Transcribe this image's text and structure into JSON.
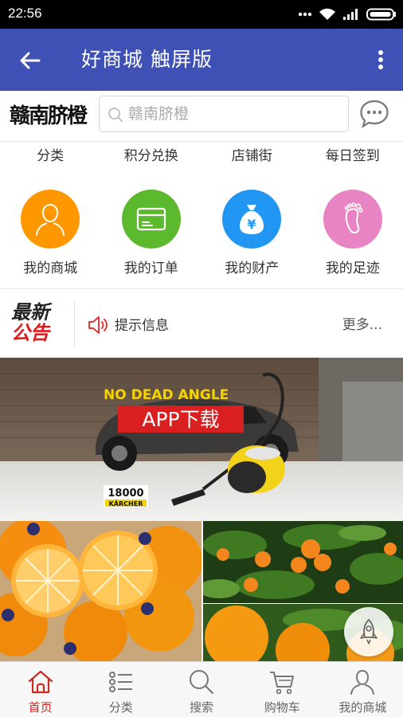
{
  "status_bar": {
    "time": "22:56"
  },
  "app_bar": {
    "title": "好商城 触屏版"
  },
  "header": {
    "logo_text": "赣南脐橙",
    "search_placeholder": "赣南脐橙"
  },
  "nav_links": [
    {
      "label": "分类"
    },
    {
      "label": "积分兑换"
    },
    {
      "label": "店铺街"
    },
    {
      "label": "每日签到"
    }
  ],
  "quick_actions": [
    {
      "label": "我的商城",
      "color": "#ff9800",
      "icon": "user-icon"
    },
    {
      "label": "我的订单",
      "color": "#5cb82c",
      "icon": "card-icon"
    },
    {
      "label": "我的财产",
      "color": "#2196f3",
      "icon": "money-bag-icon"
    },
    {
      "label": "我的足迹",
      "color": "#e884c3",
      "icon": "footprint-icon"
    }
  ],
  "notice": {
    "logo_line1": "最新",
    "logo_line2": "公告",
    "text": "提示信息",
    "more": "更多..."
  },
  "banner": {
    "headline": "NO DEAD ANGLE",
    "cta": "APP下载",
    "model_number": "18000",
    "brand": "KÄRCHER"
  },
  "colors": {
    "app_bar": "#3f51b5",
    "accent_red": "#c72b25"
  },
  "tab_bar": [
    {
      "label": "首页",
      "icon": "home-icon",
      "active": true
    },
    {
      "label": "分类",
      "icon": "list-icon",
      "active": false
    },
    {
      "label": "搜索",
      "icon": "search-icon",
      "active": false
    },
    {
      "label": "购物车",
      "icon": "cart-icon",
      "active": false
    },
    {
      "label": "我的商城",
      "icon": "user-icon",
      "active": false
    }
  ]
}
